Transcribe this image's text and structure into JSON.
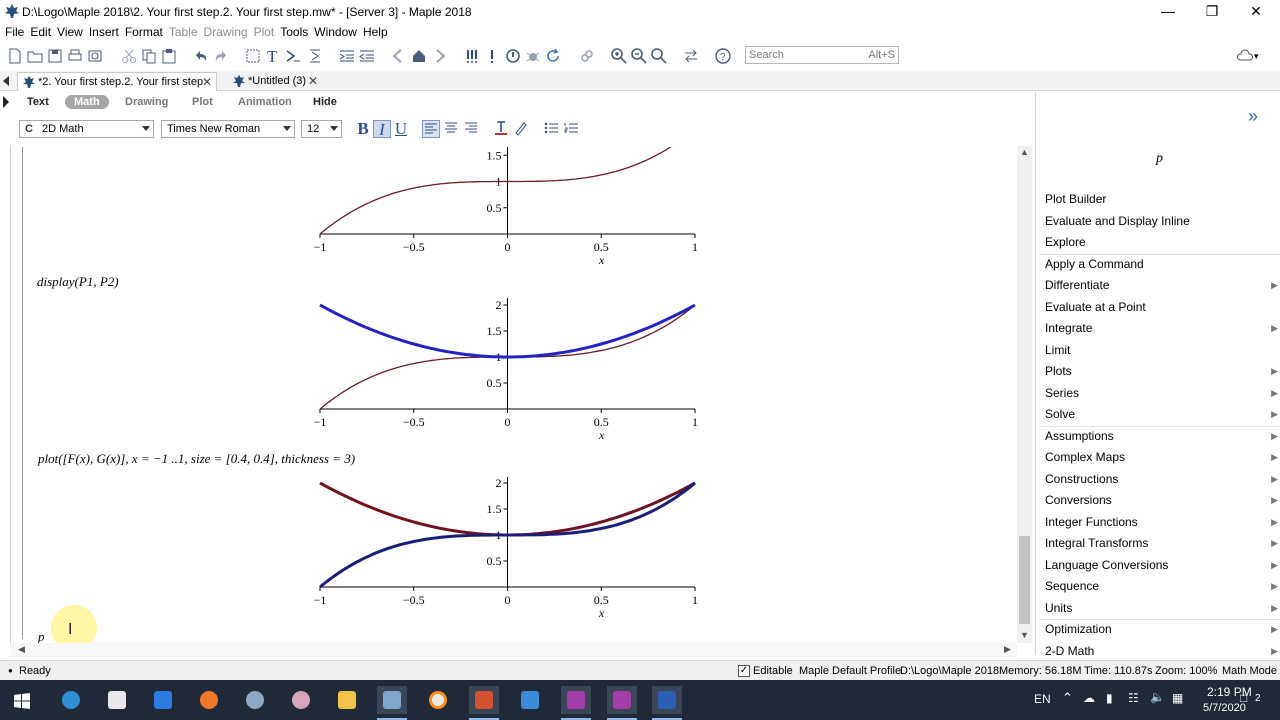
{
  "window": {
    "title": "D:\\Logo\\Maple 2018\\2. Your first step.2. Your first step.mw* - [Server 3] - Maple 2018",
    "minimize_icon": "minimize-icon",
    "maximize_icon": "restore-icon",
    "close_icon": "close-icon"
  },
  "menu": [
    "File",
    "Edit",
    "View",
    "Insert",
    "Format",
    "Table",
    "Drawing",
    "Plot",
    "Tools",
    "Window",
    "Help"
  ],
  "menu_disabled": [
    "Table",
    "Drawing",
    "Plot"
  ],
  "search": {
    "placeholder": "Search",
    "shortcut": "Alt+S"
  },
  "tabs": [
    {
      "label": "*2. Your first step.2. Your first step",
      "active": true
    },
    {
      "label": "*Untitled (3)",
      "active": false
    }
  ],
  "modes": {
    "text": "Text",
    "math": "Math",
    "drawing": "Drawing",
    "plot": "Plot",
    "animation": "Animation",
    "hide": "Hide"
  },
  "format": {
    "style": "2D Math",
    "style_prefix": "C",
    "font": "Times New Roman",
    "size": "12",
    "bold": "B",
    "italic": "I",
    "underline": "U"
  },
  "worksheet": {
    "cmd1": "display(P1, P2)",
    "cmd2": "plot([F(x), G(x)], x = −1 ..1, size = [0.4, 0.4], thickness = 3)",
    "cmd3": "p",
    "x_axis_label": "x",
    "x_ticks": [
      "−1",
      "−0.5",
      "0",
      "0.5",
      "1"
    ],
    "y_ticks": [
      "0.5",
      "1",
      "1.5",
      "2"
    ],
    "colors": {
      "curve_f": "#6b1c24",
      "curve_g": "#2323c4",
      "curve_f_thick": "#6e1320",
      "curve_g_thick": "#1b1e78"
    }
  },
  "chart_data": [
    {
      "type": "line",
      "xlabel": "x",
      "xlim": [
        -1,
        1
      ],
      "ylim": [
        0,
        1.5
      ],
      "series": [
        {
          "x": [
            -1,
            -0.5,
            0,
            0.5,
            1
          ],
          "values": [
            0,
            0.875,
            1,
            1.125,
            2
          ]
        }
      ]
    },
    {
      "type": "line",
      "xlabel": "x",
      "xlim": [
        -1,
        1
      ],
      "ylim": [
        0,
        2
      ],
      "series": [
        {
          "x": [
            -1,
            -0.5,
            0,
            0.5,
            1
          ],
          "values": [
            0,
            0.875,
            1,
            1.125,
            2
          ]
        },
        {
          "x": [
            -1,
            -0.5,
            0,
            0.5,
            1
          ],
          "values": [
            2,
            1.25,
            1,
            1.25,
            2
          ]
        }
      ]
    },
    {
      "type": "line",
      "xlabel": "x",
      "xlim": [
        -1,
        1
      ],
      "ylim": [
        0,
        2
      ],
      "series": [
        {
          "x": [
            -1,
            -0.5,
            0,
            0.5,
            1
          ],
          "values": [
            2,
            1.25,
            1,
            1.25,
            2
          ]
        },
        {
          "x": [
            -1,
            -0.5,
            0,
            0.5,
            1
          ],
          "values": [
            0,
            0.875,
            1,
            1.125,
            2
          ]
        }
      ]
    }
  ],
  "context_panel": {
    "expr": "p",
    "items": [
      {
        "label": "Plot Builder",
        "sub": false
      },
      {
        "label": "Evaluate and Display Inline",
        "sub": false
      },
      {
        "label": "Explore",
        "sub": false
      },
      {
        "label": "Apply a Command",
        "sub": false
      },
      {
        "label": "Differentiate",
        "sub": true
      },
      {
        "label": "Evaluate at a Point",
        "sub": false
      },
      {
        "label": "Integrate",
        "sub": true
      },
      {
        "label": "Limit",
        "sub": false
      },
      {
        "label": "Plots",
        "sub": true
      },
      {
        "label": "Series",
        "sub": true
      },
      {
        "label": "Solve",
        "sub": true
      },
      {
        "label": "Assumptions",
        "sub": true
      },
      {
        "label": "Complex Maps",
        "sub": true
      },
      {
        "label": "Constructions",
        "sub": true
      },
      {
        "label": "Conversions",
        "sub": true
      },
      {
        "label": "Integer Functions",
        "sub": true
      },
      {
        "label": "Integral Transforms",
        "sub": true
      },
      {
        "label": "Language Conversions",
        "sub": true
      },
      {
        "label": "Sequence",
        "sub": true
      },
      {
        "label": "Units",
        "sub": true
      },
      {
        "label": "Optimization",
        "sub": true
      },
      {
        "label": "2-D Math",
        "sub": true
      }
    ]
  },
  "status": {
    "ready": "Ready",
    "editable": "Editable",
    "profile": "Maple Default Profile",
    "path": "D:\\Logo\\Maple 2018",
    "memory": "Memory: 56.18M",
    "time": "Time: 110.87s",
    "zoom": "Zoom: 100%",
    "mode": "Math Mode"
  },
  "taskbar": {
    "lang": "EN",
    "clock_time": "2:19 PM",
    "clock_date": "5/7/2020",
    "notifications": "2"
  }
}
